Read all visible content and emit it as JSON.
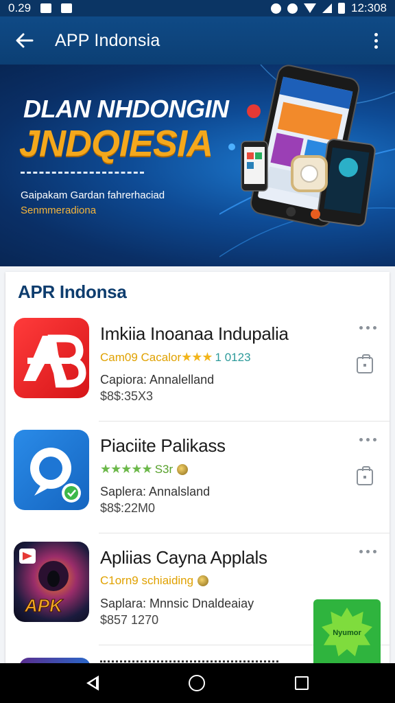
{
  "status_bar": {
    "time": "0.29",
    "clock": "12:308"
  },
  "app_bar": {
    "title": "APP Indonsia"
  },
  "banner": {
    "line1": "DLAN NHDONGIN",
    "line2": "JNDQIESIA",
    "sub1": "Gaipakam Gardan fahrerhaciad",
    "sub2": "Senmmeradiona"
  },
  "section": {
    "title": "APR Indonsa"
  },
  "apps": [
    {
      "name": "Imkiia Inoanaa Indupalia",
      "rating_label": "Cam09 Cacalor",
      "stars": "★★★",
      "rating_count": "1 0123",
      "info": "Capiora: Annalelland",
      "size": "$8$:35X3"
    },
    {
      "name": "Piaciite Palikass",
      "rating_label": "S3r",
      "stars": "★★★★★",
      "info": "Saplera: Annalsland",
      "size": "$8$:22M0"
    },
    {
      "name": "Apliias Cayna Applals",
      "rating_label": "C1orn9 schiaiding",
      "info": "Saplara: Mnnsic Dnaldeaiay",
      "size": "$857 1270"
    }
  ],
  "promo_badge": {
    "label": "Nyumor"
  },
  "colors": {
    "primary": "#0f4a86",
    "accent": "#f4a81c",
    "star": "#f2b51c"
  }
}
